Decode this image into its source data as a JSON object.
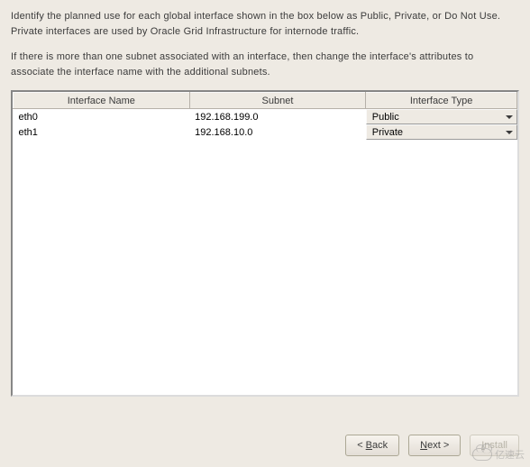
{
  "instructions": {
    "p1": "Identify the planned use for each global interface shown in the box below as Public, Private, or Do Not Use. Private interfaces are used by Oracle Grid Infrastructure for internode traffic.",
    "p2": "If there is more than one subnet associated with an interface, then change the interface's attributes to associate the interface name with the additional subnets."
  },
  "table": {
    "headers": {
      "name": "Interface Name",
      "subnet": "Subnet",
      "type": "Interface Type"
    },
    "rows": [
      {
        "name": "eth0",
        "subnet": "192.168.199.0",
        "type": "Public"
      },
      {
        "name": "eth1",
        "subnet": "192.168.10.0",
        "type": "Private"
      }
    ]
  },
  "buttons": {
    "back_prefix": "< ",
    "back_u": "B",
    "back_suffix": "ack",
    "next_u": "N",
    "next_suffix": "ext >",
    "install_u": "I",
    "install_suffix": "nstall"
  },
  "watermark": "亿速云"
}
